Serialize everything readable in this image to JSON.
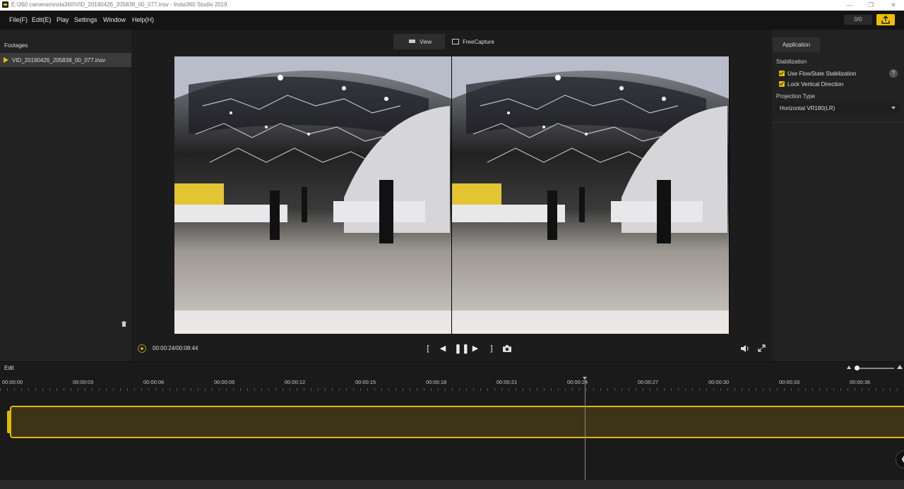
{
  "window": {
    "title": "E:\\360 cameras\\insta360\\VID_20190426_205838_00_077.insv - Insta360 Studio 2019"
  },
  "menu": {
    "items": [
      "File(F)",
      "Edit(E)",
      "Play",
      "Settings",
      "Window",
      "Help(H)"
    ],
    "counter": "0/0"
  },
  "footages": {
    "header": "Footages",
    "items": [
      "VID_20190426_205838_00_077.insv"
    ]
  },
  "viewer": {
    "tabs": {
      "view": "View",
      "freecapture": "FreeCapture"
    },
    "active_tab": "View"
  },
  "player": {
    "time": "00:00:24/00:08:44",
    "mark_in": "[",
    "mark_out": "]"
  },
  "right_panel": {
    "tab": "Application",
    "stabilization": {
      "header": "Stabilization",
      "flowstate": "Use FlowState Stabilization",
      "flowstate_checked": true,
      "lock_vertical": "Lock Vertical Direction",
      "lock_vertical_checked": true,
      "help": "?"
    },
    "projection": {
      "header": "Projection Type",
      "value": "Horizontal VR180(LR)"
    }
  },
  "edit": {
    "label": "Edit"
  },
  "timeline": {
    "ticks": [
      "00:00:00",
      "00:00:03",
      "00:00:06",
      "00:00:09",
      "00:00:12",
      "00:00:15",
      "00:00:18",
      "00:00:21",
      "00:00:24",
      "00:00:27",
      "00:00:30",
      "00:00:33",
      "00:00:36"
    ],
    "playhead": "00:00:24"
  },
  "colors": {
    "accent": "#f0c000",
    "panel": "#222222",
    "background": "#1b1b1b"
  }
}
